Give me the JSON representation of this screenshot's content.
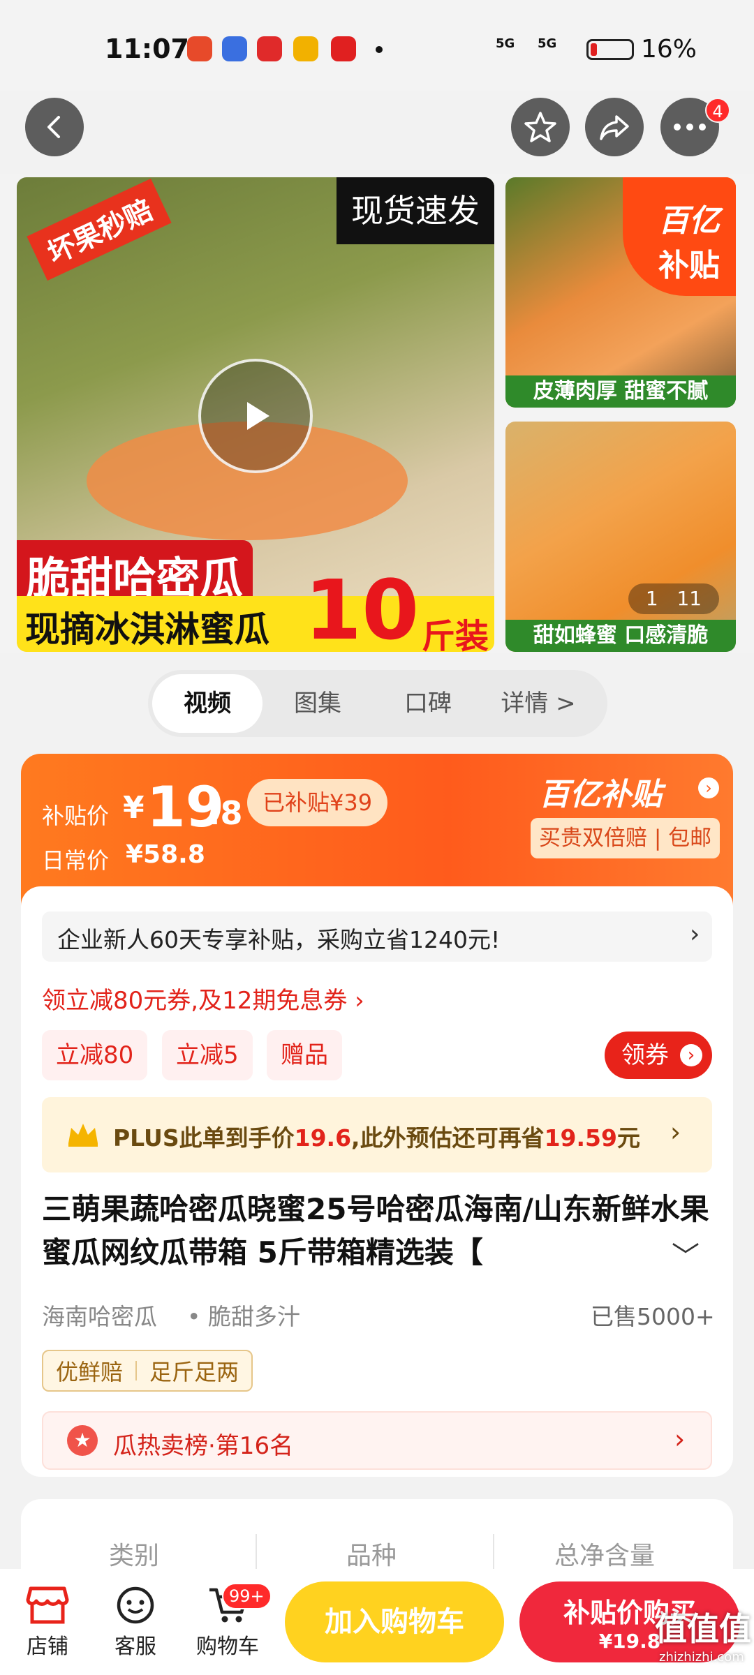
{
  "status_bar": {
    "time": "11:07",
    "battery": "16%",
    "signal1": "5G",
    "signal2": "5G",
    "battery_level": 0.16
  },
  "nav": {
    "badge_count": "4"
  },
  "gallery": {
    "main_tag_left": "坏果秒赔",
    "main_tag_right": "现货速发",
    "main_title": "脆甜哈密瓜",
    "main_sub": "现摘冰淇淋蜜瓜",
    "main_weight_num": "10",
    "main_weight_unit": "斤装",
    "side1_logo_top": "百亿",
    "side1_logo_bottom": "补贴",
    "side1_caption": "皮薄肉厚 甜蜜不腻",
    "side2_caption": "甜如蜂蜜 口感清脆",
    "side2_counter_current": "1",
    "side2_counter_total": "11"
  },
  "media_tabs": [
    "视频",
    "图集",
    "口碑",
    "详情 >"
  ],
  "price": {
    "label": "补贴价",
    "currency": "¥",
    "int": "19",
    "dec": ".8",
    "subsidy_tag": "已补贴¥39",
    "daily_label": "日常价",
    "daily_price": "¥58.8",
    "brand": "百亿补贴",
    "brand_sub": "买贵双倍赔 | 包邮"
  },
  "promo": {
    "enterprise": "企业新人60天专享补贴，采购立省1240元!",
    "coupon_line": "领立减80元券,及12期免息券 ›",
    "chips": [
      "立减80",
      "立减5",
      "赠品"
    ],
    "get_coupon": "领券",
    "plus_prefix": "PLUS此单到手价",
    "plus_price": "19.6",
    "plus_mid": ",此外预估还可再省",
    "plus_save": "19.59",
    "plus_suffix": "元"
  },
  "product": {
    "title": "三萌果蔬哈密瓜晓蜜25号哈密瓜海南/山东新鲜水果蜜瓜网纹瓜带箱 5斤带箱精选装【",
    "origin": "海南哈密瓜",
    "feature": "• 脆甜多汁",
    "sold": "已售5000+",
    "guarantee": [
      "优鲜赔",
      "足斤足两"
    ],
    "rank": "瓜热卖榜·第16名"
  },
  "specs": [
    "类别",
    "品种",
    "总净含量"
  ],
  "bottom": {
    "shop": "店铺",
    "service": "客服",
    "cart": "购物车",
    "cart_badge": "99+",
    "add_cart": "加入购物车",
    "buy_label": "补贴价购买",
    "buy_price": "¥19.8",
    "watermark": "值值值",
    "watermark_sub": "zhizhizhi.com"
  },
  "colors": {
    "accent": "#ff5b1c",
    "red": "#e2231a",
    "yellow": "#ffd21f",
    "gold": "#b07a1a"
  }
}
